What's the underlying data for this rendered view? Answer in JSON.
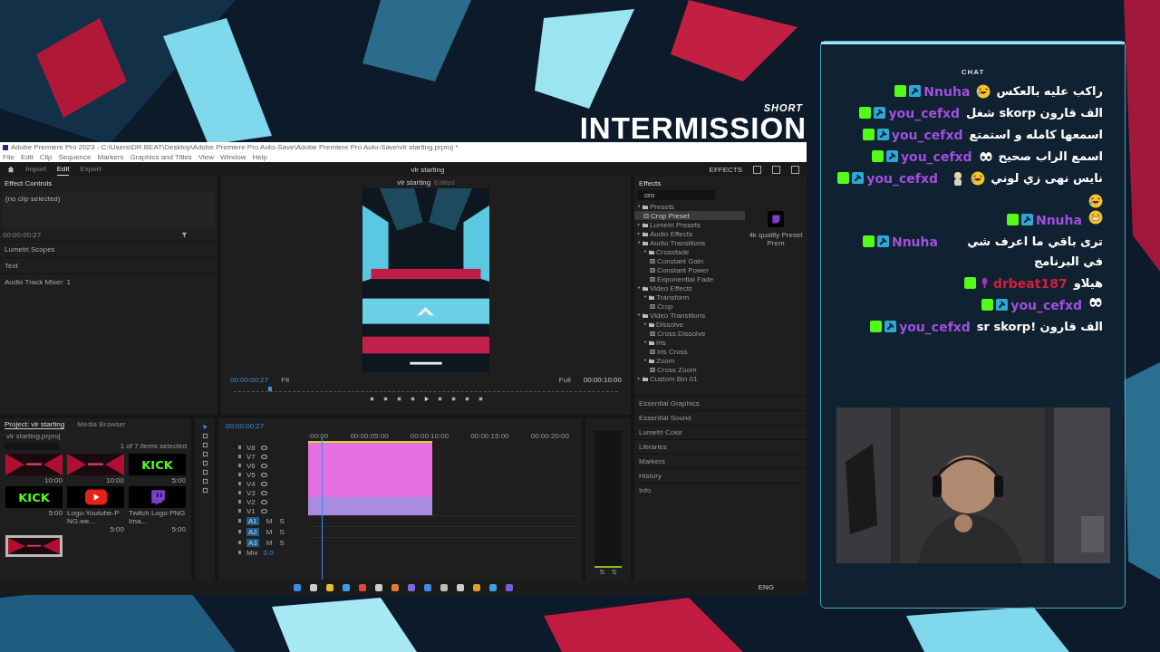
{
  "overlay_title": {
    "tag": "SHORT",
    "title": "INTERMISSION"
  },
  "premiere": {
    "title": "Adobe Premiere Pro 2023 - C:\\Users\\DR.BEAT\\Desktop\\Adobe Premiere Pro Auto-Save\\Adobe Premiere Pro Auto-Save\\vlr starting.prproj *",
    "menu": [
      "File",
      "Edit",
      "Clip",
      "Sequence",
      "Markers",
      "Graphics and Titles",
      "View",
      "Window",
      "Help"
    ],
    "workspaces": [
      {
        "label": "Import",
        "selected": false
      },
      {
        "label": "Edit",
        "selected": true
      },
      {
        "label": "Export",
        "selected": false
      }
    ],
    "sequence_name": "vlr starting",
    "workspace_label": "EFFECTS",
    "effect_controls": {
      "title": "Effect Controls",
      "clip": "(no clip selected)",
      "timecode": "00:00:00:27"
    },
    "left_tabs": [
      "Lumetri Scopes",
      "Text",
      "Audio Track Mixer: 1"
    ],
    "monitor": {
      "title": "vlr starting",
      "status": "Edited",
      "timecode": "00:00:00:27",
      "fit": "Fit",
      "quality": "Full",
      "duration": "00:00:10:00",
      "level": 0.09
    },
    "effects": {
      "title": "Effects",
      "search": "cro",
      "caption": "4k quality Preset Prem",
      "tree": [
        {
          "kind": "folder",
          "label": "Presets",
          "expanded": true,
          "selected": false,
          "children": [
            {
              "kind": "effect",
              "label": "Crop Preset",
              "selected": true
            }
          ]
        },
        {
          "kind": "folder",
          "label": "Lumetri Presets",
          "expanded": false,
          "selected": false
        },
        {
          "kind": "folder",
          "label": "Audio Effects",
          "expanded": false,
          "selected": false
        },
        {
          "kind": "folder",
          "label": "Audio Transitions",
          "expanded": true,
          "selected": false,
          "children": [
            {
              "kind": "folder",
              "label": "Crossfade",
              "expanded": true,
              "selected": false,
              "children": [
                {
                  "kind": "effect",
                  "label": "Constant Gain",
                  "selected": false
                },
                {
                  "kind": "effect",
                  "label": "Constant Power",
                  "selected": false
                },
                {
                  "kind": "effect",
                  "label": "Exponential Fade",
                  "selected": false
                }
              ]
            }
          ]
        },
        {
          "kind": "folder",
          "label": "Video Effects",
          "expanded": true,
          "selected": false,
          "children": [
            {
              "kind": "folder",
              "label": "Transform",
              "expanded": true,
              "selected": false,
              "children": [
                {
                  "kind": "effect",
                  "label": "Crop",
                  "selected": false
                }
              ]
            }
          ]
        },
        {
          "kind": "folder",
          "label": "Video Transitions",
          "expanded": true,
          "selected": false,
          "children": [
            {
              "kind": "folder",
              "label": "Dissolve",
              "expanded": true,
              "selected": false,
              "children": [
                {
                  "kind": "effect",
                  "label": "Cross Dissolve",
                  "selected": false
                }
              ]
            },
            {
              "kind": "folder",
              "label": "Iris",
              "expanded": true,
              "selected": false,
              "children": [
                {
                  "kind": "effect",
                  "label": "Iris Cross",
                  "selected": false
                }
              ]
            },
            {
              "kind": "folder",
              "label": "Zoom",
              "expanded": true,
              "selected": false,
              "children": [
                {
                  "kind": "effect",
                  "label": "Cross Zoom",
                  "selected": false
                }
              ]
            }
          ]
        },
        {
          "kind": "folder",
          "label": "Custom Bin 01",
          "expanded": false,
          "selected": false
        }
      ]
    },
    "side_panels": [
      "Essential Graphics",
      "Essential Sound",
      "Lumetri Color",
      "Libraries",
      "Markers",
      "History",
      "Info"
    ],
    "project": {
      "tabs": [
        {
          "label": "Project: vlr starting",
          "selected": true
        },
        {
          "label": "Media Browser",
          "selected": false
        }
      ],
      "file": "vlr starting.prproj",
      "count": "1 of 7 items selected",
      "items": [
        {
          "kind": "picture",
          "duration": "10:00",
          "selected": false
        },
        {
          "kind": "picture",
          "duration": "10:00",
          "selected": false
        },
        {
          "kind": "wordmark",
          "text": "KICK",
          "duration": "5:00",
          "selected": false
        },
        {
          "kind": "wordmark",
          "text": "KICK",
          "duration": "5:00",
          "selected": false
        },
        {
          "kind": "play",
          "name": "Logo-Youtube-PNG.we...",
          "duration": "5:00",
          "selected": false
        },
        {
          "kind": "chat",
          "name": "Twitch Logo PNG Ima...",
          "duration": "5:00",
          "selected": false
        },
        {
          "kind": "picture",
          "selected": true
        }
      ]
    },
    "timeline": {
      "timecode": "00:00:00:27",
      "ruler": [
        ":00:00",
        "00:00:05:00",
        "00:00:10:00",
        "00:00:15:00",
        "00:00:20:00"
      ],
      "playhead": {
        "level": 0.05
      },
      "video_tracks": [
        {
          "name": "V8",
          "color": "#e46fe0"
        },
        {
          "name": "V7",
          "color": "#e46fe0"
        },
        {
          "name": "V6",
          "color": "#e46fe0"
        },
        {
          "name": "V5",
          "color": "#e46fe0"
        },
        {
          "name": "V4",
          "color": "#e46fe0"
        },
        {
          "name": "V3",
          "color": "#e46fe0"
        },
        {
          "name": "V2",
          "color": "#a88ce0"
        },
        {
          "name": "V1",
          "color": "#a88ce0"
        }
      ],
      "audio_tracks": [
        {
          "name": "A1",
          "buttons": [
            "M",
            "S"
          ]
        },
        {
          "name": "A2",
          "buttons": [
            "M",
            "S"
          ]
        },
        {
          "name": "A3",
          "buttons": [
            "M",
            "S"
          ]
        }
      ],
      "mix": {
        "label": "Mix",
        "value": "0.0"
      }
    },
    "meter_labels": [
      "S",
      "S"
    ]
  },
  "taskbar": {
    "language": "ENG"
  },
  "chat": {
    "title": "CHAT",
    "messages": [
      {
        "user": "Nnuha",
        "color": "#a04fe0",
        "kind": "mod",
        "text": "راكب عليه بالعكس",
        "emojis": [
          {
            "kind": "laugh"
          }
        ]
      },
      {
        "user": "you_cefxd",
        "color": "#a04fe0",
        "kind": "mod",
        "text": "الف قارون skorp شغل"
      },
      {
        "user": "you_cefxd",
        "color": "#a04fe0",
        "kind": "mod",
        "text": "اسمعها كامله و استمتع"
      },
      {
        "user": "you_cefxd",
        "color": "#a04fe0",
        "kind": "mod",
        "text": "اسمع الراب صحيح",
        "emojis": [
          {
            "kind": "eyes"
          }
        ]
      },
      {
        "user": "you_cefxd",
        "color": "#a04fe0",
        "kind": "mod",
        "text": "نايس نهى زي لوني",
        "emojis": [
          {
            "kind": "laugh"
          },
          {
            "kind": "figure"
          },
          {
            "kind": "laugh"
          }
        ]
      },
      {
        "user": "Nnuha",
        "color": "#a04fe0",
        "kind": "mod",
        "emojis": [
          {
            "kind": "grin"
          }
        ]
      },
      {
        "user": "Nnuha",
        "color": "#a04fe0",
        "kind": "mod",
        "text": "ترى باقي ما اعرف شي في البرنامج"
      },
      {
        "user": "drbeat187",
        "color": "#d0203a",
        "kind": "mic",
        "text": "هيلاو"
      },
      {
        "user": "you_cefxd",
        "color": "#a04fe0",
        "kind": "mod",
        "emojis": [
          {
            "kind": "eyes"
          }
        ]
      },
      {
        "user": "you_cefxd",
        "color": "#a04fe0",
        "kind": "mod",
        "text": "الف قارون !sr skorp"
      }
    ]
  }
}
